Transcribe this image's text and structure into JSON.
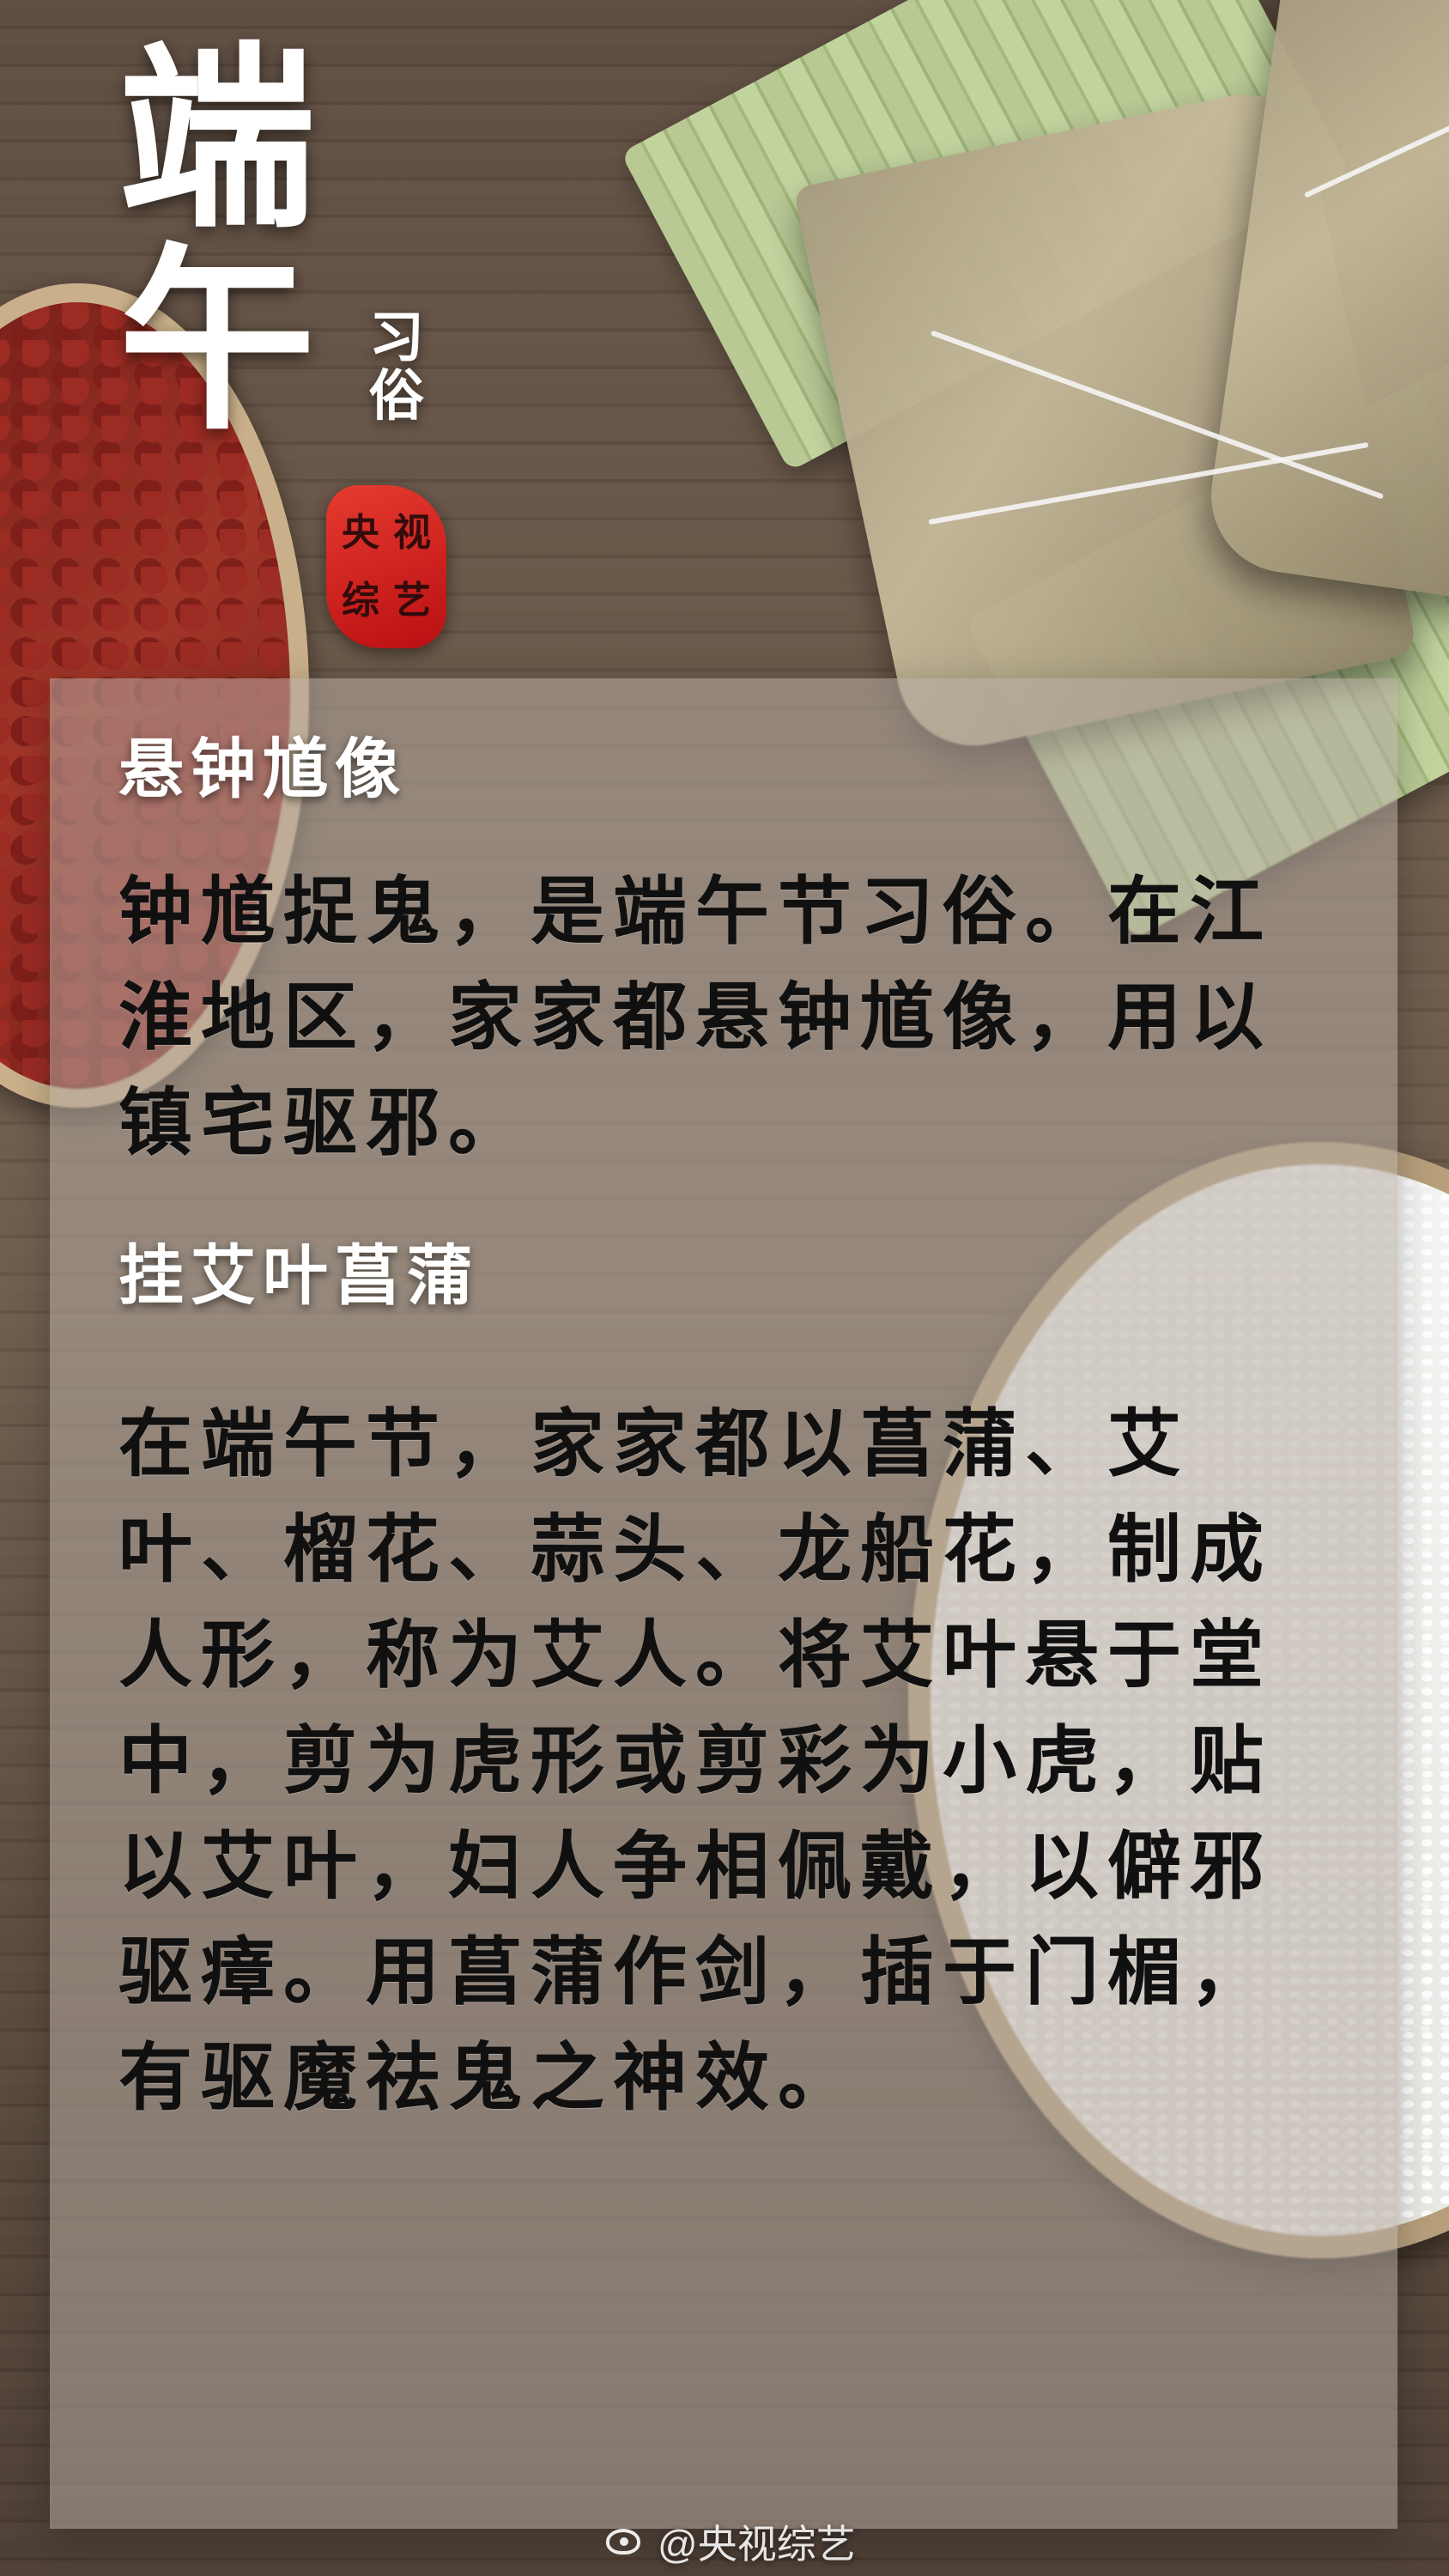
{
  "header": {
    "title_chars": [
      "端",
      "午"
    ],
    "subtitle_chars": [
      "习",
      "俗"
    ],
    "seal_chars": [
      "央",
      "视",
      "综",
      "艺"
    ]
  },
  "sections": [
    {
      "heading": "悬钟馗像",
      "body": "钟馗捉鬼，是端午节习俗。在江淮地区，家家都悬钟馗像，用以镇宅驱邪。"
    },
    {
      "heading": "挂艾叶菖蒲",
      "body": "在端午节，家家都以菖蒲、艾叶、榴花、蒜头、龙船花，制成人形，称为艾人。将艾叶悬于堂中，剪为虎形或剪彩为小虎，贴以艾叶，妇人争相佩戴，以僻邪驱瘴。用菖蒲作剑，插于门楣，有驱魔祛鬼之神效。"
    }
  ],
  "watermark": {
    "text": "@央视综艺"
  },
  "icons": {
    "seal_icon": "seal-icon",
    "weibo_icon": "weibo-logo-icon"
  },
  "colors": {
    "title": "#ffffff",
    "seal": "#d62822",
    "text": "#101010",
    "panel": "rgba(180,170,160,0.55)"
  }
}
